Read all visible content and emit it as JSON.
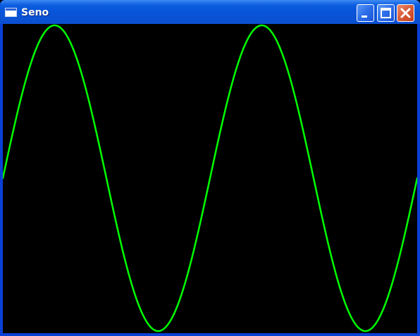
{
  "window": {
    "title": "Seno",
    "icon": "app-window-icon",
    "controls": [
      "minimize-icon",
      "maximize-icon",
      "close-icon"
    ]
  },
  "canvas": {
    "background": "#000000",
    "curve_color": "#00ff00",
    "function": "sine",
    "periods": 2,
    "phase_start": 0
  }
}
